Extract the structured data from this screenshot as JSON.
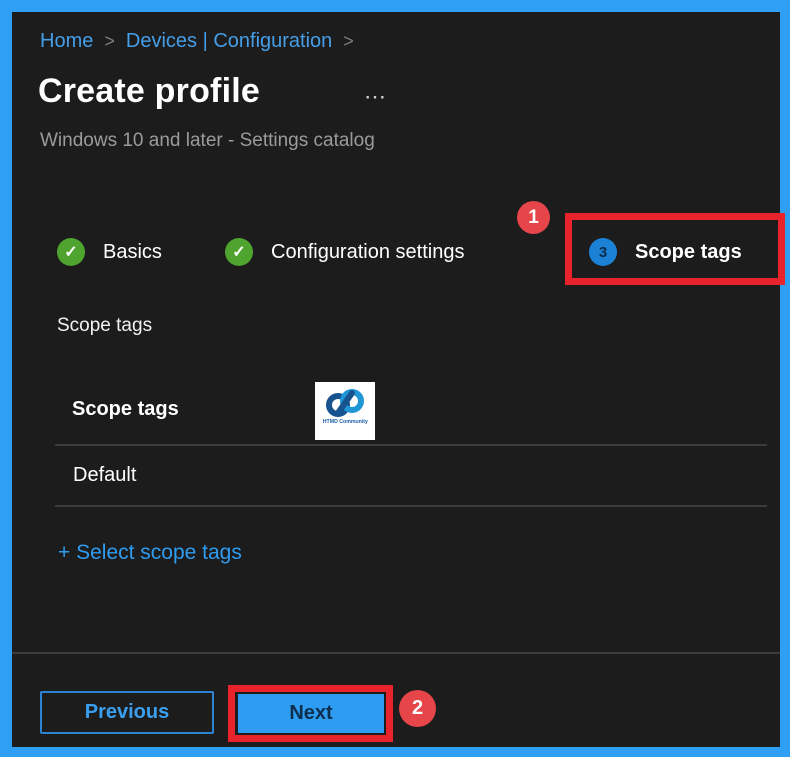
{
  "colors": {
    "frame_blue": "#2e9ff2",
    "background": "#1c1c1c",
    "link_blue": "#3b9ff0",
    "annotation_red": "#e8232b",
    "step_complete_green": "#4ea42e",
    "step_current_blue": "#1c82d6",
    "next_button_blue": "#2e9cf0"
  },
  "breadcrumb": {
    "items": [
      {
        "label": "Home"
      },
      {
        "label": "Devices | Configuration"
      }
    ],
    "separator": ">"
  },
  "header": {
    "title": "Create profile",
    "menu_ellipsis": "⋯",
    "subtitle": "Windows 10 and later - Settings catalog"
  },
  "wizard": {
    "steps": [
      {
        "label": "Basics",
        "status": "complete"
      },
      {
        "label": "Configuration settings",
        "status": "complete"
      },
      {
        "label": "Scope tags",
        "status": "current",
        "number": "3"
      }
    ]
  },
  "icons": {
    "check": "✓"
  },
  "section": {
    "label": "Scope tags"
  },
  "scope_table": {
    "header": "Scope tags",
    "rows": [
      "Default"
    ]
  },
  "logo": {
    "caption": "HTMD Community"
  },
  "links": {
    "select_scope_tags": "+ Select scope tags"
  },
  "footer": {
    "previous_label": "Previous",
    "next_label": "Next"
  },
  "annotations": {
    "badge_step": "1",
    "badge_next": "2"
  }
}
